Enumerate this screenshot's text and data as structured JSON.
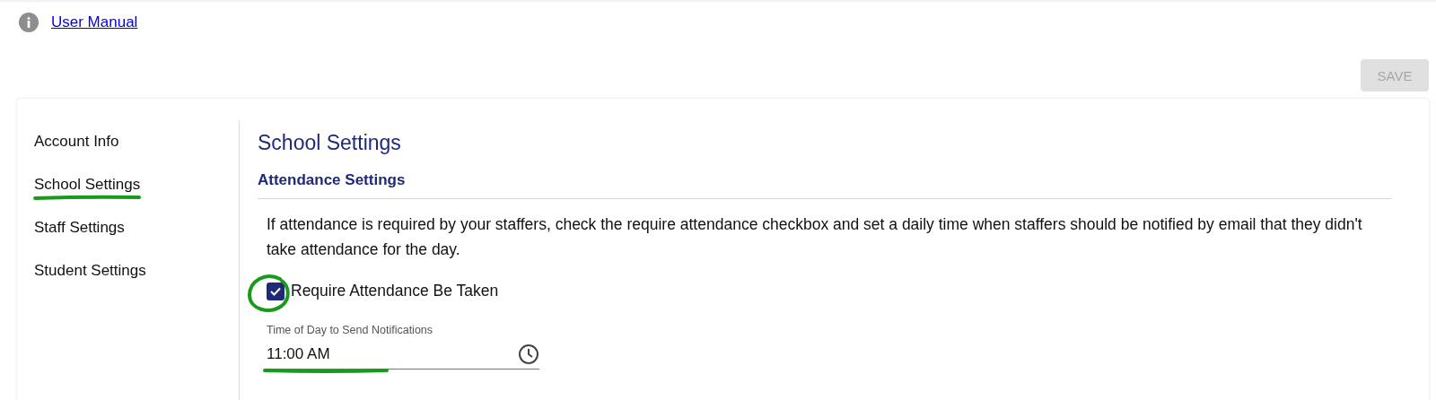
{
  "help_link": {
    "label": "User Manual"
  },
  "save_button": {
    "label": "SAVE",
    "disabled": true
  },
  "sidebar": {
    "items": [
      {
        "label": "Account Info",
        "annotated": false
      },
      {
        "label": "School Settings",
        "annotated": true
      },
      {
        "label": "Staff Settings",
        "annotated": false
      },
      {
        "label": "Student Settings",
        "annotated": false
      }
    ]
  },
  "page_title": "School Settings",
  "section": {
    "title": "Attendance Settings",
    "description": "If attendance is required by your staffers, check the require attendance checkbox and set a daily time when staffers should be notified by email that they didn't take attendance for the day.",
    "checkbox": {
      "label": "Require Attendance Be Taken",
      "checked": true,
      "annotated": true
    },
    "time_field": {
      "label": "Time of Day to Send Notifications",
      "value": "11:00 AM",
      "annotated": true
    }
  }
}
